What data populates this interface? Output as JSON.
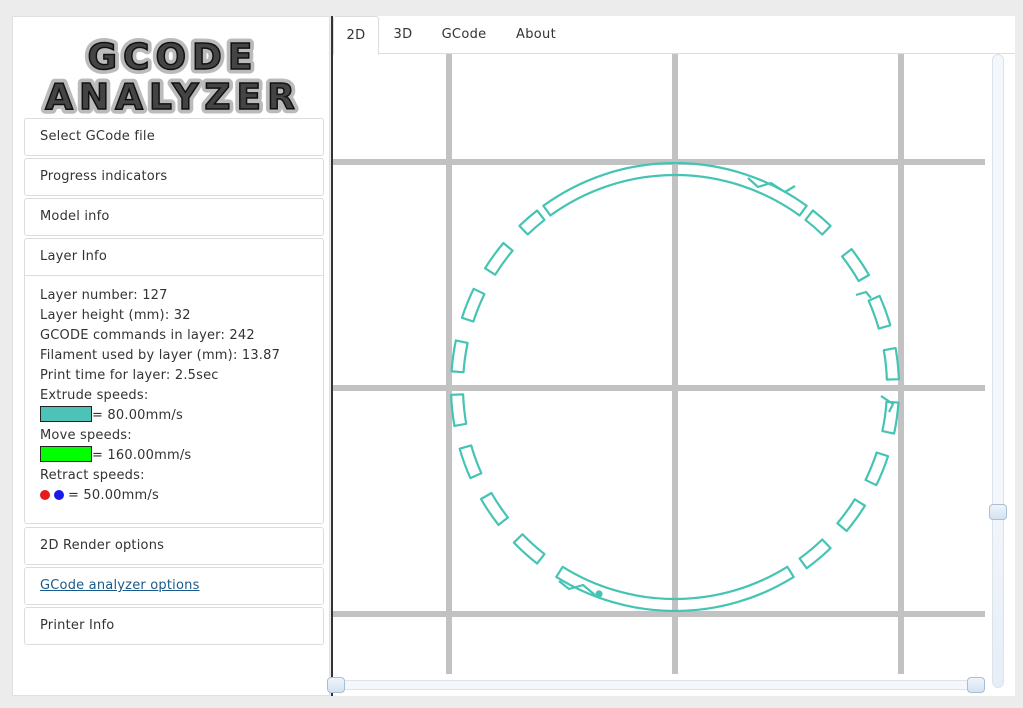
{
  "logo": {
    "line1": "GCODE",
    "line2": "ANALYZER"
  },
  "sidebar": {
    "panels": [
      {
        "label": "Select GCode file"
      },
      {
        "label": "Progress indicators"
      },
      {
        "label": "Model info"
      },
      {
        "label": "Layer Info"
      },
      {
        "label": "2D Render options"
      },
      {
        "label": "GCode analyzer options"
      },
      {
        "label": "Printer Info"
      }
    ],
    "layer_info": {
      "layer_number": "Layer number: 127",
      "layer_height": "Layer height (mm): 32",
      "commands": "GCODE commands in layer: 242",
      "filament": "Filament used by layer (mm): 13.87",
      "print_time": "Print time for layer: 2.5sec",
      "extrude_title": "Extrude speeds:",
      "extrude_value": "= 80.00mm/s",
      "move_title": "Move speeds:",
      "move_value": "= 160.00mm/s",
      "retract_title": "Retract speeds:",
      "retract_value": "= 50.00mm/s"
    }
  },
  "tabs": [
    {
      "label": "2D",
      "active": true
    },
    {
      "label": "3D",
      "active": false
    },
    {
      "label": "GCode",
      "active": false
    },
    {
      "label": "About",
      "active": false
    }
  ],
  "colors": {
    "extrude": "#4dc3b8",
    "move": "#00ff00",
    "retract_a": "#e81a1a",
    "retract_b": "#1a1ae8",
    "grid": "#c2c2c2",
    "toolpath": "#45c4b3"
  },
  "layer_slider": {
    "value": 127
  }
}
